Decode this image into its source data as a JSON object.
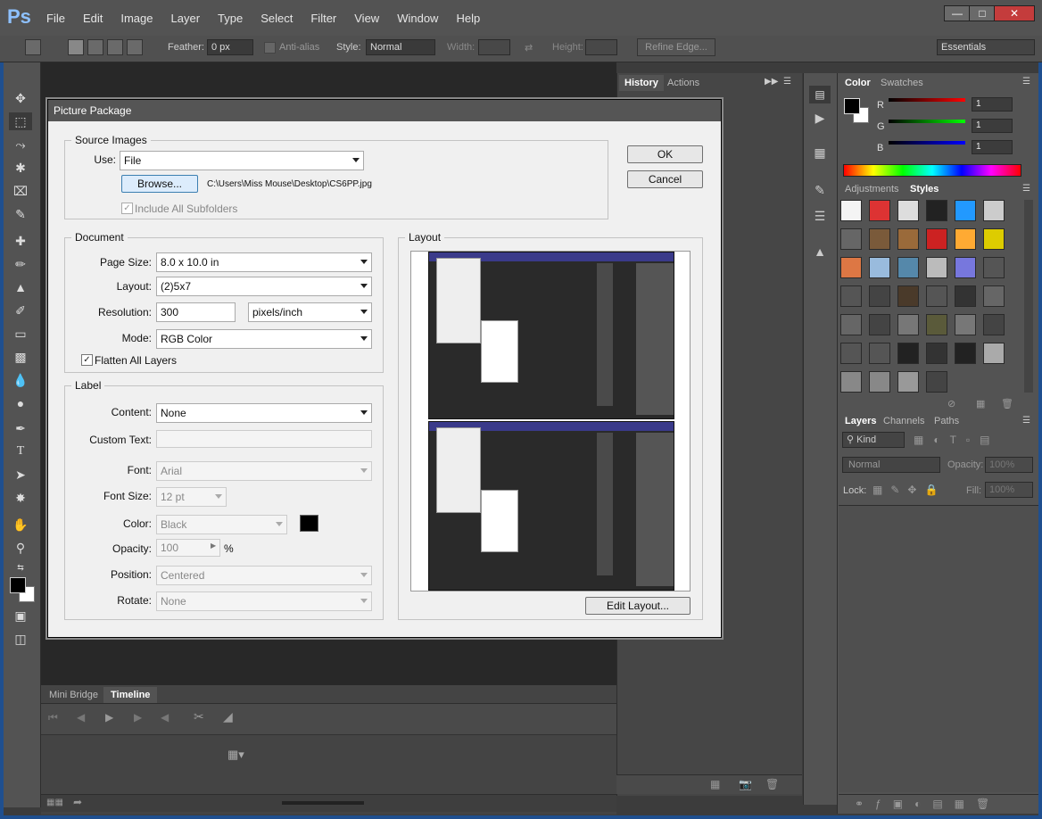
{
  "app": {
    "logo": "Ps",
    "menu": [
      "File",
      "Edit",
      "Image",
      "Layer",
      "Type",
      "Select",
      "Filter",
      "View",
      "Window",
      "Help"
    ],
    "window_buttons": [
      "minimize-icon",
      "maximize-icon",
      "close-icon"
    ]
  },
  "options_bar": {
    "feather_label": "Feather:",
    "feather_value": "0 px",
    "antialias_label": "Anti-alias",
    "style_label": "Style:",
    "style_value": "Normal",
    "width_label": "Width:",
    "height_label": "Height:",
    "refine_edge": "Refine Edge...",
    "workspace": "Essentials"
  },
  "panels": {
    "history_tab": "History",
    "actions_tab": "Actions",
    "color_tab": "Color",
    "swatches_tab": "Swatches",
    "r_label": "R",
    "g_label": "G",
    "b_label": "B",
    "r_value": "1",
    "g_value": "1",
    "b_value": "1",
    "adjustments_tab": "Adjustments",
    "styles_tab": "Styles",
    "layers_tab": "Layers",
    "channels_tab": "Channels",
    "paths_tab": "Paths",
    "kind_label": "Kind",
    "blend_mode": "Normal",
    "opacity_label": "Opacity:",
    "opacity_value": "100%",
    "lock_label": "Lock:",
    "fill_label": "Fill:",
    "fill_value": "100%",
    "mini_bridge_tab": "Mini Bridge",
    "timeline_tab": "Timeline"
  },
  "dialog": {
    "title": "Picture Package",
    "ok": "OK",
    "cancel": "Cancel",
    "source_images": "Source Images",
    "use_label": "Use:",
    "use_value": "File",
    "browse": "Browse...",
    "file_path": "C:\\Users\\Miss Mouse\\Desktop\\CS6PP.jpg",
    "include_subfolders": "Include All Subfolders",
    "document": "Document",
    "page_size_label": "Page Size:",
    "page_size_value": "8.0 x 10.0 in",
    "layout_label": "Layout:",
    "layout_value": "(2)5x7",
    "resolution_label": "Resolution:",
    "resolution_value": "300",
    "resolution_unit": "pixels/inch",
    "mode_label": "Mode:",
    "mode_value": "RGB Color",
    "flatten_label": "Flatten All Layers",
    "label_group": "Label",
    "content_label": "Content:",
    "content_value": "None",
    "custom_text_label": "Custom Text:",
    "font_label": "Font:",
    "font_value": "Arial",
    "font_size_label": "Font Size:",
    "font_size_value": "12 pt",
    "color_label": "Color:",
    "color_value": "Black",
    "opacity_label": "Opacity:",
    "opacity_value": "100",
    "percent": "%",
    "position_label": "Position:",
    "position_value": "Centered",
    "rotate_label": "Rotate:",
    "rotate_value": "None",
    "layout_group": "Layout",
    "edit_layout": "Edit Layout...",
    "swatch_color": "#000000"
  },
  "colors": {
    "accent": "#1f4f8f",
    "ps_blue": "#8ec1ff"
  }
}
